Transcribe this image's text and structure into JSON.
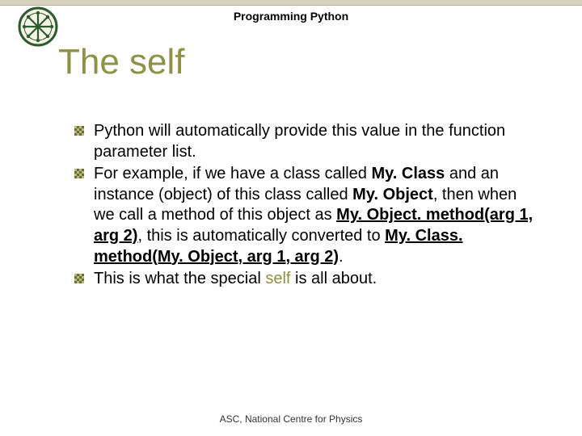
{
  "header": {
    "course": "Programming Python"
  },
  "title": "The self",
  "bullets": {
    "b1": "Python will automatically provide this value in the function parameter list.",
    "b2_prefix": "For example, if we have a class called ",
    "b2_class": "My. Class",
    "b2_mid1": " and an instance (object) of this class called ",
    "b2_obj": "My. Object",
    "b2_mid2": ", then when we call a method of this object as ",
    "b2_call1": "My. Object. method(arg 1, arg 2)",
    "b2_mid3": ", this is automatically converted to ",
    "b2_call2": "My. Class. method(My. Object, arg 1, arg 2)",
    "b2_end": ".",
    "b3_prefix": "This is what the special ",
    "b3_self": "self",
    "b3_suffix": " is all about."
  },
  "footer": "ASC, National Centre for Physics"
}
